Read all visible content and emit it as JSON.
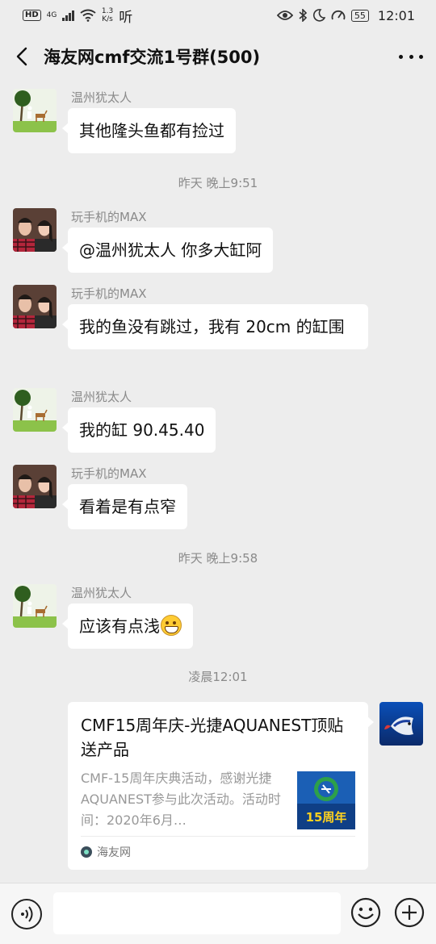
{
  "status_bar": {
    "hd": "HD",
    "network": "4G",
    "speed_value": "1.3",
    "speed_unit": "K/s",
    "listen": "听",
    "battery": "55",
    "time": "12:01"
  },
  "header": {
    "title": "海友网cmf交流1号群(500)"
  },
  "messages": [
    {
      "sender": "温州犹太人",
      "text": "其他隆头鱼都有捡过"
    },
    {
      "timestamp": "昨天 晚上9:51"
    },
    {
      "sender": "玩手机的MAX",
      "text": "@温州犹太人 你多大缸阿"
    },
    {
      "sender": "玩手机的MAX",
      "text": "我的鱼没有跳过，我有 20cm 的缸围"
    },
    {
      "sender": "温州犹太人",
      "text": "我的缸 90.45.40"
    },
    {
      "sender": "玩手机的MAX",
      "text": "看着是有点窄"
    },
    {
      "timestamp": "昨天 晚上9:58"
    },
    {
      "sender": "温州犹太人",
      "text": "应该有点浅",
      "emoji": "grin-emoji"
    },
    {
      "timestamp": "凌晨12:01"
    }
  ],
  "link_card": {
    "title": "CMF15周年庆-光捷AQUANEST顶贴送产品",
    "description": "CMF-15周年庆典活动，感谢光捷AQUANEST参与此次活动。活动时间：2020年6月…",
    "thumb_text": "15周年",
    "source": "海友网"
  },
  "colors": {
    "background": "#ededed",
    "bubble": "#ffffff",
    "meta_text": "#8a8a8a"
  }
}
